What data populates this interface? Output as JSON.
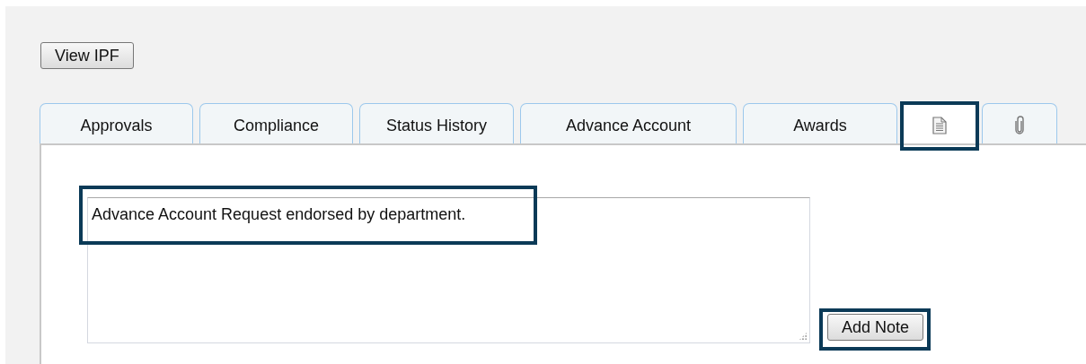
{
  "view_button": {
    "label": "View IPF"
  },
  "tabs": [
    {
      "kind": "text",
      "label": "Approvals",
      "selected": false,
      "highlighted": false
    },
    {
      "kind": "text",
      "label": "Compliance",
      "selected": false,
      "highlighted": false
    },
    {
      "kind": "text",
      "label": "Status History",
      "selected": false,
      "highlighted": false
    },
    {
      "kind": "text",
      "label": "Advance Account",
      "selected": false,
      "highlighted": false
    },
    {
      "kind": "text",
      "label": "Awards",
      "selected": false,
      "highlighted": false
    },
    {
      "kind": "doc",
      "selected": true,
      "highlighted": true
    },
    {
      "kind": "clip",
      "selected": false,
      "highlighted": false
    }
  ],
  "note": {
    "value": "Advance Account Request endorsed by department.",
    "highlighted": true
  },
  "add_button": {
    "label": "Add Note",
    "highlighted": true
  }
}
